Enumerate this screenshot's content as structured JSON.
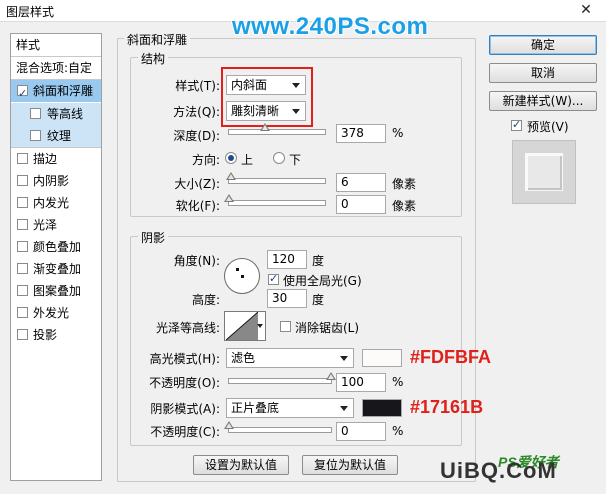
{
  "window": {
    "title": "图层样式",
    "close_glyph": "✕"
  },
  "watermark_top": "www.240PS.com",
  "watermark_bottom": {
    "main": "UiBQ.CoM",
    "ps": "PS爱好者"
  },
  "sidebar": {
    "header": "样式",
    "blend": "混合选项:自定",
    "items": [
      {
        "label": "斜面和浮雕",
        "checked": true
      },
      {
        "label": "等高线",
        "checked": false
      },
      {
        "label": "纹理",
        "checked": false
      },
      {
        "label": "描边",
        "checked": false
      },
      {
        "label": "内阴影",
        "checked": false
      },
      {
        "label": "内发光",
        "checked": false
      },
      {
        "label": "光泽",
        "checked": false
      },
      {
        "label": "颜色叠加",
        "checked": false
      },
      {
        "label": "渐变叠加",
        "checked": false
      },
      {
        "label": "图案叠加",
        "checked": false
      },
      {
        "label": "外发光",
        "checked": false
      },
      {
        "label": "投影",
        "checked": false
      }
    ]
  },
  "bevel": {
    "group_title": "斜面和浮雕",
    "structure_title": "结构",
    "style_label": "样式(T):",
    "style_value": "内斜面",
    "technique_label": "方法(Q):",
    "technique_value": "雕刻清晰",
    "depth_label": "深度(D):",
    "depth_value": "378",
    "depth_unit": "%",
    "depth_fraction": 0.38,
    "direction_label": "方向:",
    "direction_up": "上",
    "direction_down": "下",
    "size_label": "大小(Z):",
    "size_value": "6",
    "size_unit": "像素",
    "size_fraction": 0.02,
    "soften_label": "软化(F):",
    "soften_value": "0",
    "soften_unit": "像素",
    "soften_fraction": 0.0
  },
  "shading": {
    "title": "阴影",
    "angle_label": "角度(N):",
    "angle_value": "120",
    "angle_unit": "度",
    "global_light_label": "使用全局光(G)",
    "altitude_label": "高度:",
    "altitude_value": "30",
    "altitude_unit": "度",
    "gloss_label": "光泽等高线:",
    "antialias_label": "消除锯齿(L)",
    "highlight_mode_label": "高光模式(H):",
    "highlight_mode_value": "滤色",
    "highlight_color": "#FDFBFA",
    "highlight_annotation": "#FDFBFA",
    "highlight_opacity_label": "不透明度(O):",
    "highlight_opacity_value": "100",
    "highlight_opacity_fraction": 1.0,
    "shadow_mode_label": "阴影模式(A):",
    "shadow_mode_value": "正片叠底",
    "shadow_color": "#17161B",
    "shadow_annotation": "#17161B",
    "shadow_opacity_label": "不透明度(C):",
    "shadow_opacity_value": "0",
    "shadow_opacity_fraction": 0.0,
    "percent": "%"
  },
  "footer": {
    "set_default": "设置为默认值",
    "reset_default": "复位为默认值"
  },
  "actions": {
    "ok": "确定",
    "cancel": "取消",
    "new_style": "新建样式(W)...",
    "preview": "预览(V)",
    "preview_checked": true
  },
  "colors": {
    "accent_red": "#e0201b",
    "watermark_blue": "#1aa0e6",
    "selection": "#99c9ef"
  }
}
